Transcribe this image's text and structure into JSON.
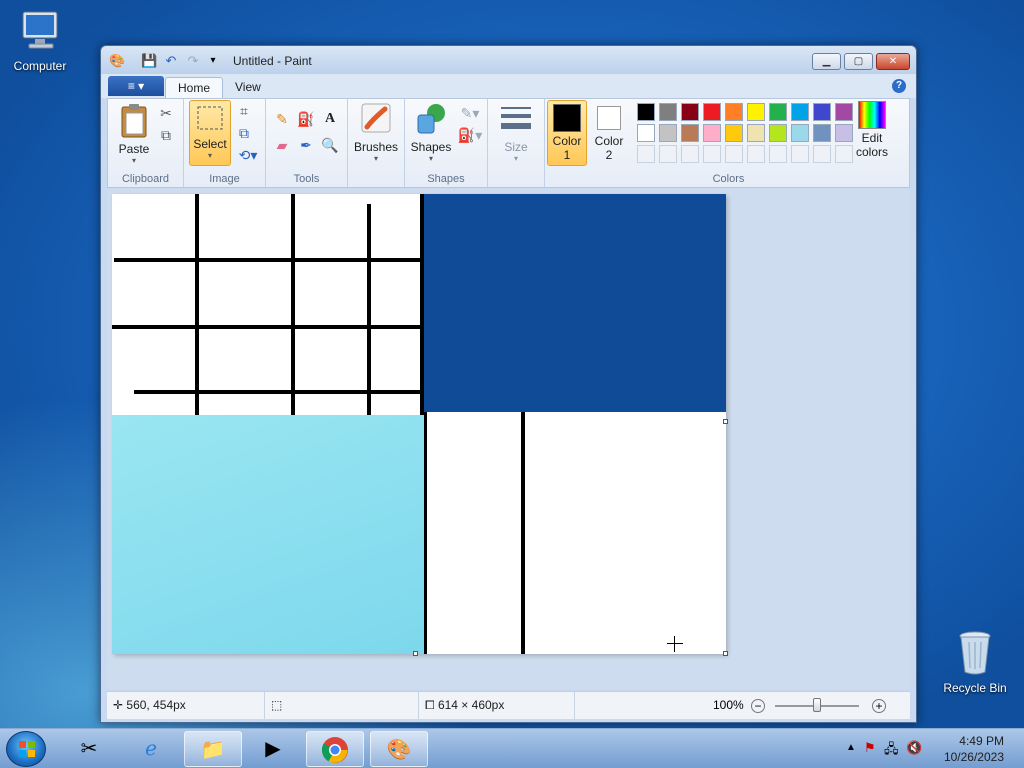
{
  "desktop": {
    "icons": {
      "computer": "Computer",
      "recycle_bin": "Recycle Bin"
    }
  },
  "window": {
    "title": "Untitled - Paint",
    "file_tab": "≡ ▾",
    "tabs": [
      "Home",
      "View"
    ],
    "help": "?"
  },
  "ribbon": {
    "clipboard": {
      "group": "Clipboard",
      "paste": "Paste"
    },
    "image": {
      "group": "Image",
      "select": "Select"
    },
    "tools": {
      "group": "Tools"
    },
    "brushes": {
      "label": "Brushes"
    },
    "shapes": {
      "group": "Shapes",
      "label": "Shapes"
    },
    "size": {
      "label": "Size"
    },
    "colors": {
      "group": "Colors",
      "color1_a": "Color",
      "color1_b": "1",
      "color2_a": "Color",
      "color2_b": "2",
      "edit_a": "Edit",
      "edit_b": "colors",
      "color1_value": "#000000",
      "color2_value": "#ffffff",
      "palette": [
        "#000000",
        "#7f7f7f",
        "#880015",
        "#ed1c24",
        "#ff7f27",
        "#fff200",
        "#22b14c",
        "#00a2e8",
        "#3f48cc",
        "#a349a4",
        "#ffffff",
        "#c3c3c3",
        "#b97a57",
        "#ffaec9",
        "#ffc90e",
        "#efe4b0",
        "#b5e61d",
        "#99d9ea",
        "#7092be",
        "#c8bfe7"
      ]
    }
  },
  "canvas_content": {
    "dark_blue": "#0f4b96",
    "light_blue": "#8fe1f0"
  },
  "status": {
    "cursor_pos": "560, 454px",
    "image_size": "614 × 460px",
    "zoom": "100%"
  },
  "taskbar": {
    "time": "4:49 PM",
    "date": "10/26/2023"
  }
}
